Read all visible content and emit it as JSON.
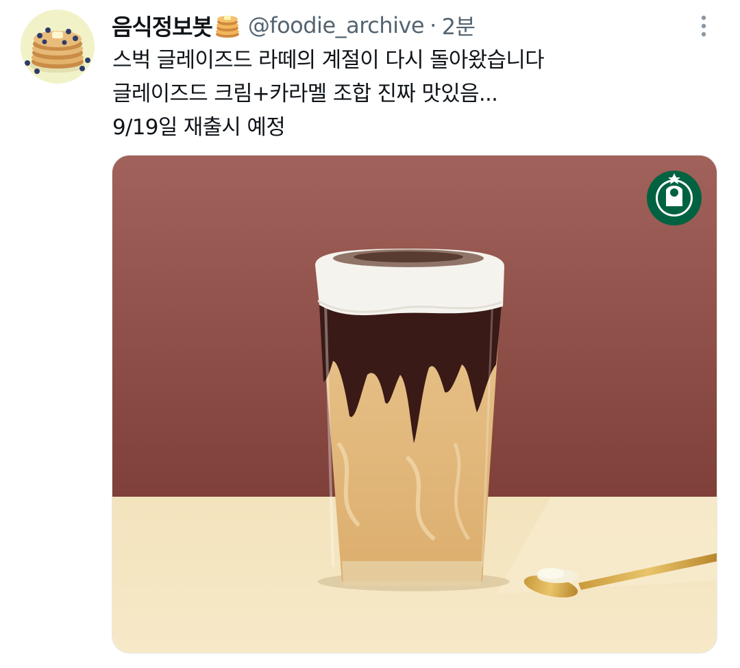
{
  "author": {
    "display_name": "음식정보봇",
    "name_emoji": "pancakes-emoji",
    "handle": "@foodie_archive",
    "separator": "·",
    "timestamp": "2분",
    "avatar": "pancake-stack-avatar"
  },
  "tweet": {
    "lines": [
      "스벅 글레이즈드 라떼의 계절이 다시 돌아왔습니다",
      "글레이즈드 크림+카라멜 조합 진짜 맛있음...",
      "9/19일 재출시 예정"
    ]
  },
  "media": {
    "subject": "glazed-latte-glass",
    "logo": "starbucks-logo",
    "background_color": "#8e4e45",
    "table_color": "#f1dfb5"
  },
  "colors": {
    "text_primary": "#0f1419",
    "text_secondary": "#536471",
    "icon_more": "#8b98a5"
  }
}
